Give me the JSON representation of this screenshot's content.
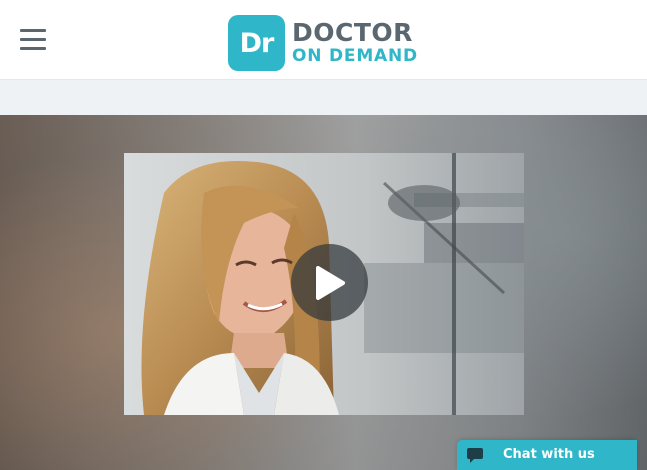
{
  "colors": {
    "brand_blue": "#2fb6c8",
    "brand_dark": "#5b6770",
    "chat_bg": "#2fb6c8"
  },
  "header": {
    "menu_icon": "hamburger-menu-icon",
    "logo": {
      "badge_text": "Dr",
      "line1": "DOCTOR",
      "line2": "ON DEMAND"
    }
  },
  "hero": {
    "play_icon": "play-icon"
  },
  "chat": {
    "icon": "chat-bubble-icon",
    "label": "Chat with us"
  }
}
